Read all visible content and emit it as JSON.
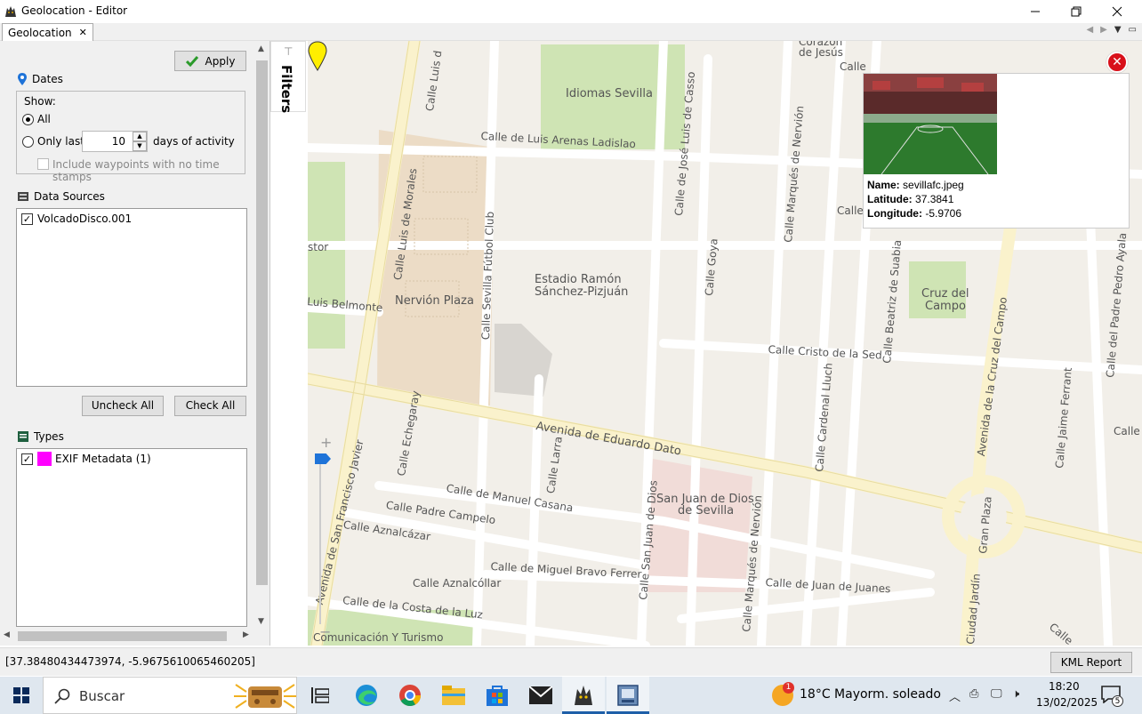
{
  "window": {
    "title": "Geolocation - Editor"
  },
  "tabs": [
    {
      "label": "Geolocation"
    }
  ],
  "left_panel": {
    "apply_label": "Apply",
    "dates": {
      "title": "Dates",
      "show_label": "Show:",
      "option_all": "All",
      "option_only_last": "Only last",
      "days_value": "10",
      "days_suffix": "days of activity",
      "include_waypoints": "Include waypoints with no time stamps"
    },
    "data_sources": {
      "title": "Data Sources",
      "items": [
        {
          "label": "VolcadoDisco.001",
          "checked": true
        }
      ],
      "uncheck_all": "Uncheck All",
      "check_all": "Check All"
    },
    "types": {
      "title": "Types",
      "items": [
        {
          "label": "EXIF Metadata (1)",
          "checked": true,
          "color": "#ff00ff"
        }
      ]
    }
  },
  "filters_tab": {
    "label": "Filters"
  },
  "map": {
    "labels": {
      "corazon": "Corazón",
      "de_jesus": "de Jesús",
      "calle_top": "Calle",
      "idiomas": "Idiomas Sevilla",
      "luis_arenas": "Calle de Luis Arenas Ladislao",
      "jose_luis_casso": "Calle de José Luis de Casso",
      "marques_nervion": "Calle Marqués de Nervión",
      "calle_right": "Calle",
      "luis_morales": "Calle Luis de Morales",
      "calle_luis_top": "Calle Luis d",
      "stor": "stor",
      "estadio_1": "Estadio Ramón",
      "estadio_2": "Sánchez-Pizjuán",
      "nervion_plaza": "Nervión Plaza",
      "sevilla_futbol": "Calle Sevilla Fútbol Club",
      "luis_belmonte": "Luis Belmonte",
      "goya": "Calle Goya",
      "beatriz": "Calle Beatriz de Suabia",
      "cruz_campo_1": "Cruz del",
      "cruz_campo_2": "Campo",
      "avenida_cruz": "Avenida de la Cruz del Campo",
      "pedro_ayala": "Calle del Padre Pedro Ayala",
      "cristo_sed": "Calle Cristo de la Sed",
      "cardenal_lluch": "Calle Cardenal Lluch",
      "jaime_ferrant": "Calle Jaime Ferrant",
      "calle_du": "Calle Du",
      "eduardo_dato": "Avenida de Eduardo Dato",
      "echegaray": "Calle Echegaray",
      "larra": "Calle Larra",
      "san_francisco": "Avenida de San Francisco Javier",
      "manuel_casana": "Calle de Manuel Casana",
      "padre_campelo": "Calle Padre Campelo",
      "aznalcazar": "Calle Aznalcázar",
      "san_juan_1": "San Juan de Dios",
      "san_juan_2": "de Sevilla",
      "calle_san_juan": "Calle San Juan de Dios",
      "marques_nervion_2": "Calle Marqués de Nervión",
      "miguel_bravo": "Calle de Miguel Bravo Ferrer",
      "juan_juanes": "Calle de Juan de Juanes",
      "aznalcollar": "Calle Aznalcóllar",
      "costa_luz": "Calle de la Costa de la Luz",
      "comunicacion": "Comunicación Y Turismo",
      "gran_plaza": "Gran Plaza",
      "ciudad_jardin": "Ciudad Jardín",
      "calle_bottom_right": "Calle"
    },
    "popup": {
      "name_label": "Name:",
      "name_value": "sevillafc.jpeg",
      "lat_label": "Latitude:",
      "lat_value": "37.3841",
      "lon_label": "Longitude:",
      "lon_value": "-5.9706"
    }
  },
  "status_bar": {
    "coordinates": "[37.38480434473974, -5.96756100654602​05]",
    "kml_report": "KML Report"
  },
  "taskbar": {
    "search_placeholder": "Buscar",
    "weather": "18°C  Mayorm. soleado",
    "weather_badge": "1",
    "time": "18:20",
    "date": "13/02/2025",
    "notification_count": "5"
  }
}
